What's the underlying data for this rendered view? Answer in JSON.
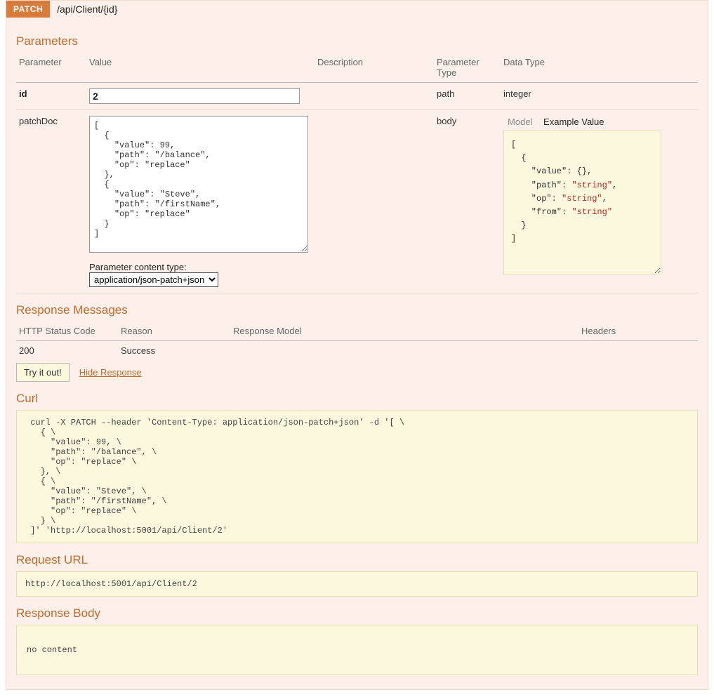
{
  "header": {
    "method": "PATCH",
    "path": "/api/Client/{id}"
  },
  "sections": {
    "parameters": "Parameters",
    "responseMessages": "Response Messages",
    "curl": "Curl",
    "requestUrl": "Request URL",
    "responseBody": "Response Body"
  },
  "paramHeaders": {
    "parameter": "Parameter",
    "value": "Value",
    "description": "Description",
    "paramType": "Parameter Type",
    "dataType": "Data Type"
  },
  "params": {
    "id": {
      "name": "id",
      "value": "2",
      "description": "",
      "paramType": "path",
      "dataType": "integer"
    },
    "patchDoc": {
      "name": "patchDoc",
      "value": "[\n  {\n    \"value\": 99,\n    \"path\": \"/balance\",\n    \"op\": \"replace\"\n  },\n  {\n    \"value\": \"Steve\",\n    \"path\": \"/firstName\",\n    \"op\": \"replace\"\n  }\n]",
      "description": "",
      "paramType": "body",
      "contentTypeLabel": "Parameter content type:",
      "contentTypeValue": "application/json-patch+json",
      "tabs": {
        "model": "Model",
        "example": "Example Value"
      },
      "exampleLines": [
        "[",
        "  {",
        "    \"value\": {},",
        "    \"path\": \"string\",",
        "    \"op\": \"string\",",
        "    \"from\": \"string\"",
        "  }",
        "]"
      ]
    }
  },
  "respHeaders": {
    "code": "HTTP Status Code",
    "reason": "Reason",
    "model": "Response Model",
    "headers": "Headers"
  },
  "respRow": {
    "code": "200",
    "reason": "Success"
  },
  "buttons": {
    "try": "Try it out!",
    "hide": "Hide Response"
  },
  "curl": " curl -X PATCH --header 'Content-Type: application/json-patch+json' -d '[ \\\n   { \\\n     \"value\": 99, \\\n     \"path\": \"/balance\", \\\n     \"op\": \"replace\" \\\n   }, \\\n   { \\\n     \"value\": \"Steve\", \\\n     \"path\": \"/firstName\", \\\n     \"op\": \"replace\" \\\n   } \\\n ]' 'http://localhost:5001/api/Client/2'",
  "requestUrl": "http://localhost:5001/api/Client/2",
  "responseBody": "no content"
}
